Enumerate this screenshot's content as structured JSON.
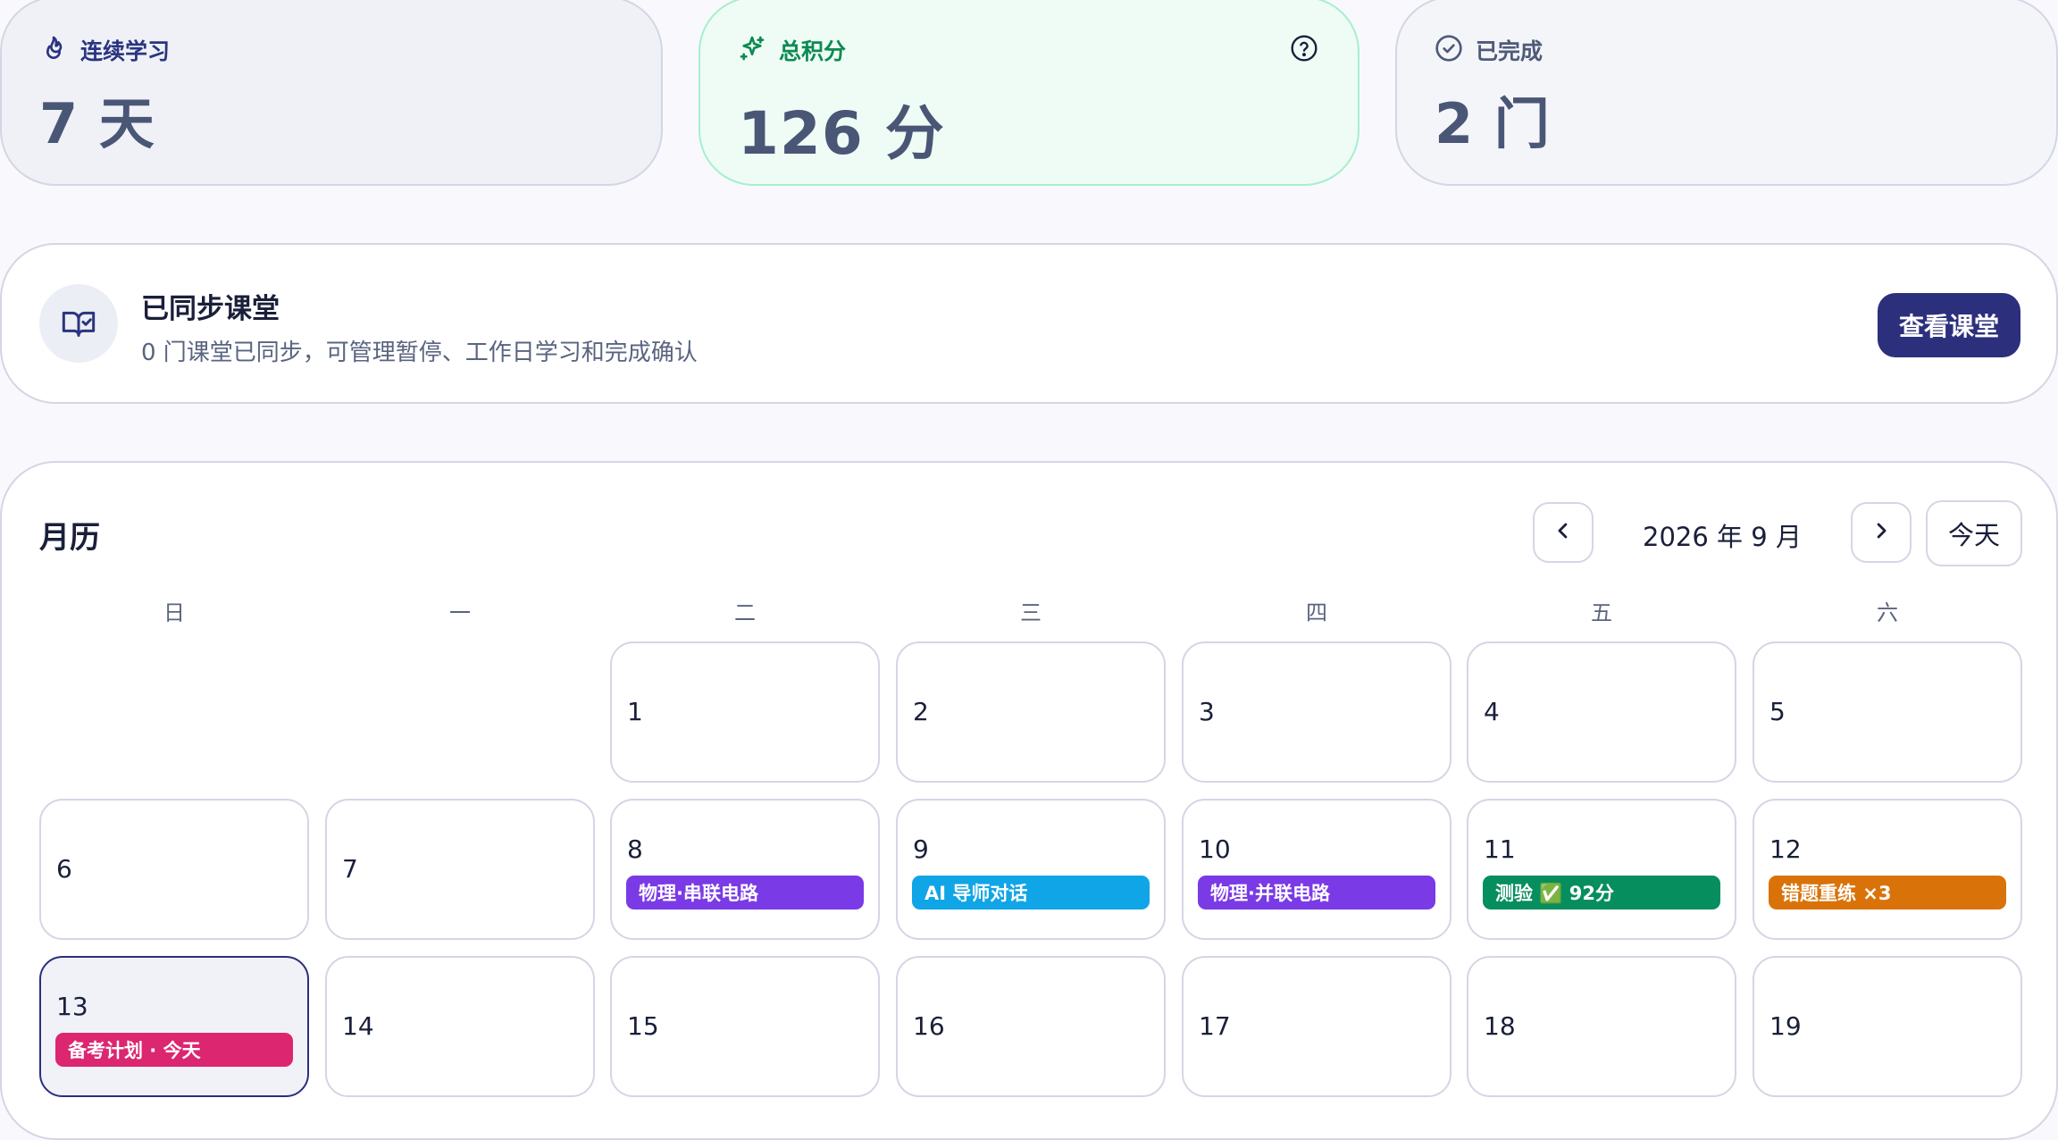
{
  "stats": [
    {
      "label": "连续学习",
      "value": "7 天",
      "icon": "flame-icon",
      "color": "#2a3580"
    },
    {
      "label": "总积分",
      "value": "126 分",
      "icon": "sparkle-icon",
      "color": "#0d8a52",
      "help_icon": "help-circle-icon"
    },
    {
      "label": "已完成",
      "value": "2 门",
      "icon": "check-circle-icon",
      "color": "#4e5a78"
    }
  ],
  "classroom": {
    "icon": "book-check-icon",
    "title": "已同步课堂",
    "description": "0 门课堂已同步，可管理暂停、工作日学习和完成确认",
    "button_label": "查看课堂"
  },
  "calendar": {
    "title": "月历",
    "month_label": "2026 年 9 月",
    "today_label": "今天",
    "prev_icon": "chevron-left-icon",
    "next_icon": "chevron-right-icon",
    "weekdays": [
      "日",
      "一",
      "二",
      "三",
      "四",
      "五",
      "六"
    ],
    "weeks": [
      [
        null,
        null,
        {
          "day": "1"
        },
        {
          "day": "2"
        },
        {
          "day": "3"
        },
        {
          "day": "4"
        },
        {
          "day": "5"
        }
      ],
      [
        {
          "day": "6"
        },
        {
          "day": "7"
        },
        {
          "day": "8",
          "event": "物理·串联电路",
          "color": "#7a3ae6"
        },
        {
          "day": "9",
          "event": "AI 导师对话",
          "color": "#10a5e6"
        },
        {
          "day": "10",
          "event": "物理·并联电路",
          "color": "#7a3ae6"
        },
        {
          "day": "11",
          "event": "测验 ✅ 92分",
          "color": "#068e5f"
        },
        {
          "day": "12",
          "event": "错题重练 ×3",
          "color": "#d97309"
        }
      ],
      [
        {
          "day": "13",
          "event": "备考计划 · 今天",
          "color": "#dc2670",
          "today": true
        },
        {
          "day": "14"
        },
        {
          "day": "15"
        },
        {
          "day": "16"
        },
        {
          "day": "17"
        },
        {
          "day": "18"
        },
        {
          "day": "19"
        }
      ]
    ]
  }
}
